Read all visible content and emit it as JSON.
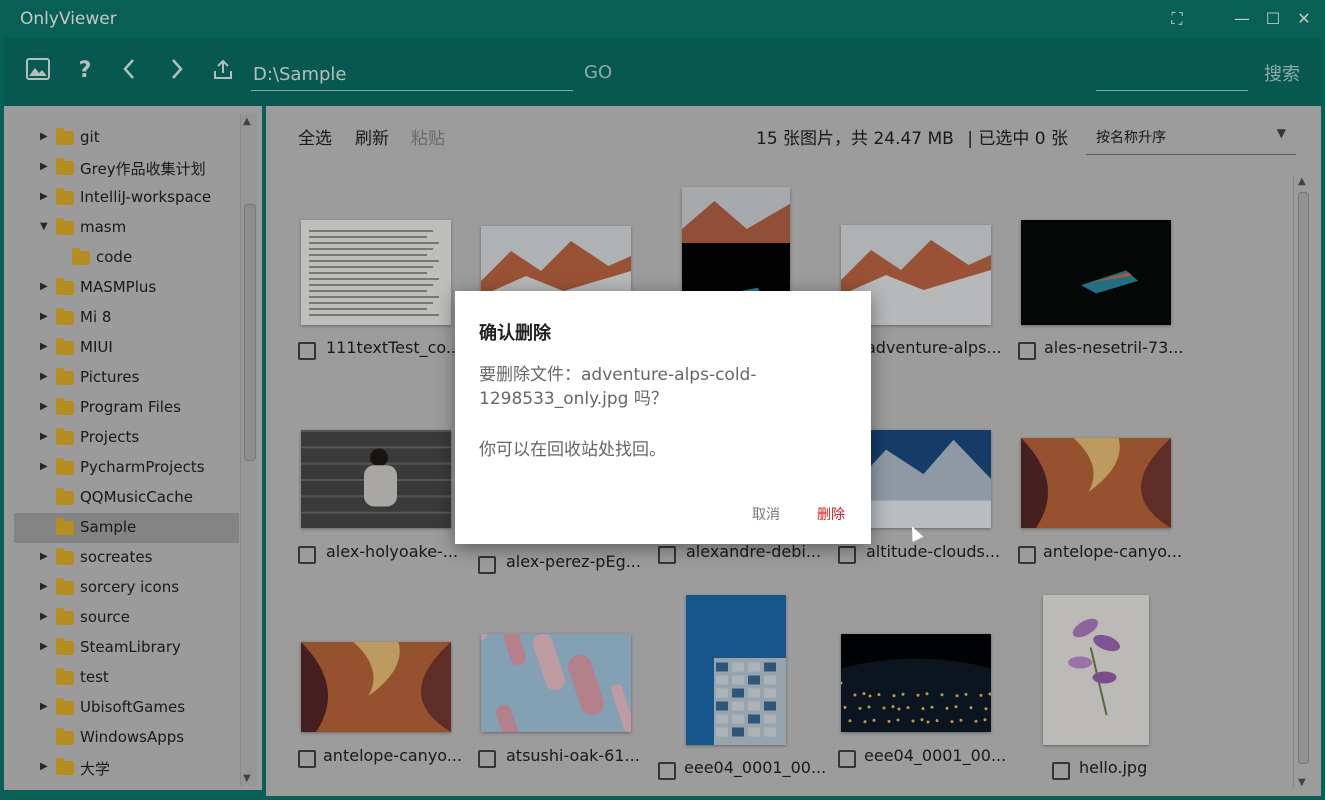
{
  "app": {
    "title": "OnlyViewer"
  },
  "toolbar": {
    "help": "?",
    "path_value": "D:\\Sample",
    "go_label": "GO",
    "search_label": "搜索",
    "search_value": ""
  },
  "tree": {
    "items": [
      {
        "label": "git",
        "arrow": "▶",
        "depth": 0,
        "selected": false
      },
      {
        "label": "Grey作品收集计划",
        "arrow": "▶",
        "depth": 0,
        "selected": false
      },
      {
        "label": "IntelliJ-workspace",
        "arrow": "▶",
        "depth": 0,
        "selected": false
      },
      {
        "label": "masm",
        "arrow": "▼",
        "depth": 0,
        "selected": false
      },
      {
        "label": "code",
        "arrow": "",
        "depth": 1,
        "selected": false
      },
      {
        "label": "MASMPlus",
        "arrow": "▶",
        "depth": 0,
        "selected": false
      },
      {
        "label": "Mi 8",
        "arrow": "▶",
        "depth": 0,
        "selected": false
      },
      {
        "label": "MIUI",
        "arrow": "▶",
        "depth": 0,
        "selected": false
      },
      {
        "label": "Pictures",
        "arrow": "▶",
        "depth": 0,
        "selected": false
      },
      {
        "label": "Program Files",
        "arrow": "▶",
        "depth": 0,
        "selected": false
      },
      {
        "label": "Projects",
        "arrow": "▶",
        "depth": 0,
        "selected": false
      },
      {
        "label": "PycharmProjects",
        "arrow": "▶",
        "depth": 0,
        "selected": false
      },
      {
        "label": "QQMusicCache",
        "arrow": "",
        "depth": 0,
        "selected": false
      },
      {
        "label": "Sample",
        "arrow": "",
        "depth": 0,
        "selected": true
      },
      {
        "label": "socreates",
        "arrow": "▶",
        "depth": 0,
        "selected": false
      },
      {
        "label": "sorcery icons",
        "arrow": "▶",
        "depth": 0,
        "selected": false
      },
      {
        "label": "source",
        "arrow": "▶",
        "depth": 0,
        "selected": false
      },
      {
        "label": "SteamLibrary",
        "arrow": "▶",
        "depth": 0,
        "selected": false
      },
      {
        "label": "test",
        "arrow": "",
        "depth": 0,
        "selected": false
      },
      {
        "label": "UbisoftGames",
        "arrow": "▶",
        "depth": 0,
        "selected": false
      },
      {
        "label": "WindowsApps",
        "arrow": "",
        "depth": 0,
        "selected": false
      },
      {
        "label": "大学",
        "arrow": "▶",
        "depth": 0,
        "selected": false
      }
    ]
  },
  "actions": {
    "select_all": "全选",
    "refresh": "刷新",
    "paste": "粘贴"
  },
  "status": {
    "summary": "15 张图片，共 24.47 MB",
    "selected": "| 已选中 0 张"
  },
  "sort": {
    "selected": "按名称升序"
  },
  "files": [
    {
      "name": "111textTest_co...",
      "thumb": "document"
    },
    {
      "name": "",
      "thumb": "mountain-snow"
    },
    {
      "name": "",
      "thumb": "mountain-laptop"
    },
    {
      "name": "adventure-alps...",
      "thumb": "mountain-snow"
    },
    {
      "name": "ales-nesetril-73...",
      "thumb": "laptop-dark"
    },
    {
      "name": "alex-holyoake-...",
      "thumb": "person-stairs"
    },
    {
      "name": "alex-perez-pEg...",
      "thumb": "hidden"
    },
    {
      "name": "alexandre-debi...",
      "thumb": "hidden"
    },
    {
      "name": "altitude-clouds...",
      "thumb": "mountain-blue"
    },
    {
      "name": "antelope-canyo...",
      "thumb": "canyon"
    },
    {
      "name": "antelope-canyo...",
      "thumb": "canyon"
    },
    {
      "name": "atsushi-oak-61...",
      "thumb": "cherry-blossom"
    },
    {
      "name": "eee04_0001_00...",
      "thumb": "building"
    },
    {
      "name": "eee04_0001_00...",
      "thumb": "earth-night"
    },
    {
      "name": "hello.jpg",
      "thumb": "flower"
    }
  ],
  "dialog": {
    "title": "确认删除",
    "message": "要删除文件：adventure-alps-cold-1298533_only.jpg 吗？",
    "hint": "你可以在回收站处找回。",
    "cancel": "取消",
    "delete": "删除"
  },
  "colors": {
    "accent": "#0b7a6e",
    "toolbar": "#087168",
    "danger": "#d71e1e"
  }
}
